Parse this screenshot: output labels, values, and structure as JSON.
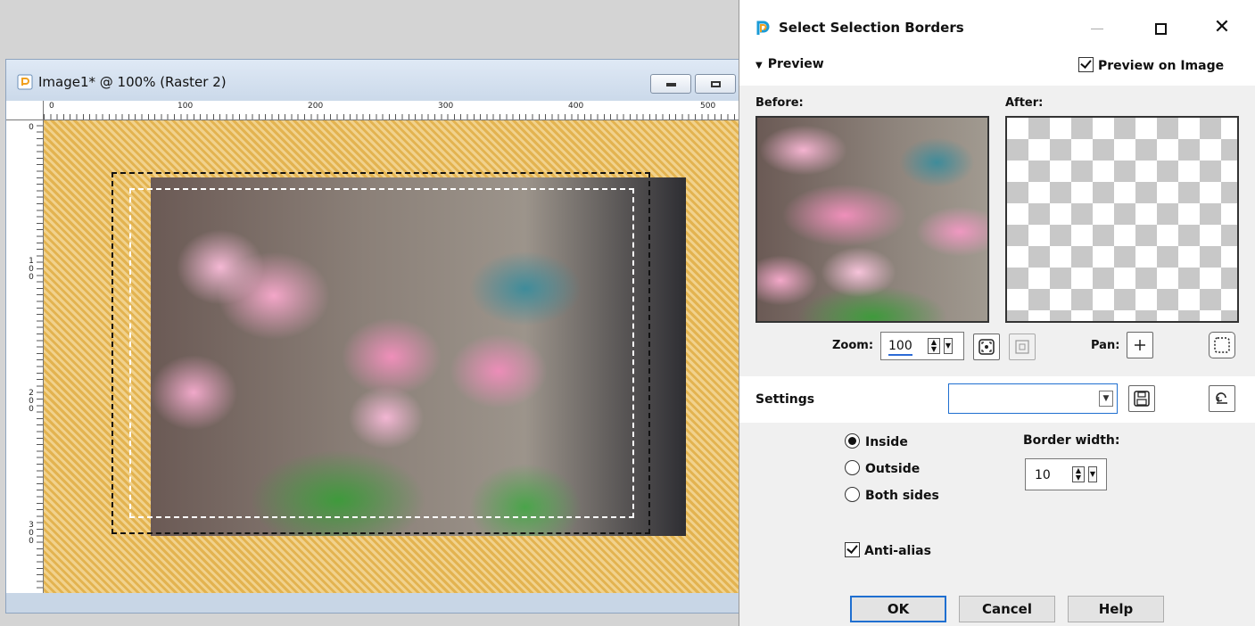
{
  "image_window": {
    "title": "Image1* @ 100% (Raster 2)",
    "ruler_top_ticks": [
      "0",
      "100",
      "200",
      "300",
      "400",
      "500"
    ],
    "ruler_left_ticks": [
      "0",
      "100",
      "200",
      "300"
    ]
  },
  "dialog": {
    "title": "Select Selection Borders",
    "close_glyph": "✕",
    "preview": {
      "toggle_label": "Preview",
      "preview_on_image_label": "Preview on Image",
      "preview_on_image_checked": true,
      "before_label": "Before:",
      "after_label": "After:",
      "zoom_label": "Zoom:",
      "zoom_value": "100",
      "pan_label": "Pan:"
    },
    "settings": {
      "label": "Settings",
      "selected_value": ""
    },
    "options": {
      "radios": [
        {
          "label": "Inside",
          "checked": true
        },
        {
          "label": "Outside",
          "checked": false
        },
        {
          "label": "Both sides",
          "checked": false
        }
      ],
      "border_width_label": "Border width:",
      "border_width_value": "10",
      "antialias_label": "Anti-alias",
      "antialias_checked": true
    },
    "buttons": {
      "ok": "OK",
      "cancel": "Cancel",
      "help": "Help"
    }
  },
  "colors": {
    "accent": "#1f6fd0",
    "canvas_stripe_light": "#f1d28d",
    "canvas_stripe_dark": "#e3b350"
  }
}
